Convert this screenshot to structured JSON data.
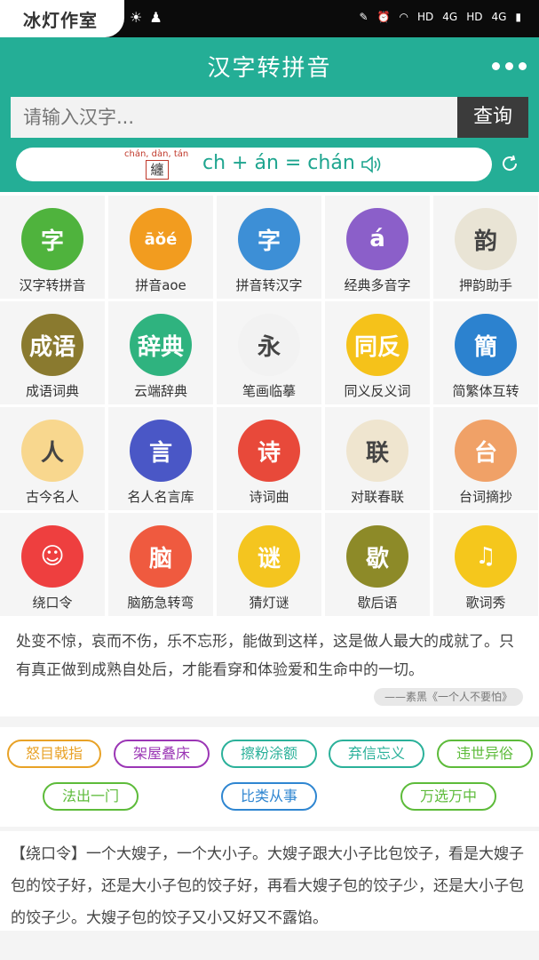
{
  "status_bar": {
    "brand": "冰灯作室",
    "signal_labels": [
      "HD",
      "4G",
      "HD",
      "4G"
    ]
  },
  "app_bar": {
    "title": "汉字转拼音"
  },
  "search": {
    "placeholder": "请输入汉字...",
    "button_label": "查询"
  },
  "pinyin_demo": {
    "small_pinyin": "chán, dàn, tán",
    "character": "纏",
    "formula": "ch + án = chán"
  },
  "grid": [
    {
      "label": "汉字转拼音",
      "icon": "hanzi-to-pinyin-icon",
      "color": "#4fb33d",
      "glyph": "字"
    },
    {
      "label": "拼音aoe",
      "icon": "pinyin-aoe-icon",
      "color": "#f29c1f",
      "glyph": "āǒé"
    },
    {
      "label": "拼音转汉字",
      "icon": "pinyin-to-hanzi-icon",
      "color": "#3d8fd6",
      "glyph": "字"
    },
    {
      "label": "经典多音字",
      "icon": "polyphone-icon",
      "color": "#8b5fc9",
      "glyph": "á"
    },
    {
      "label": "押韵助手",
      "icon": "rhyme-icon",
      "color": "#e9e4d5",
      "glyph": "韵"
    },
    {
      "label": "成语词典",
      "icon": "idiom-dictionary-icon",
      "color": "#8a7a2f",
      "glyph": "成语"
    },
    {
      "label": "云端辞典",
      "icon": "cloud-dictionary-icon",
      "color": "#2fb37f",
      "glyph": "辞典"
    },
    {
      "label": "笔画临摹",
      "icon": "stroke-practice-icon",
      "color": "#f2f2f2",
      "glyph": "永"
    },
    {
      "label": "同义反义词",
      "icon": "synonym-icon",
      "color": "#f5c21a",
      "glyph": "同反"
    },
    {
      "label": "简繁体互转",
      "icon": "simplified-traditional-icon",
      "color": "#2c82cf",
      "glyph": "簡"
    },
    {
      "label": "古今名人",
      "icon": "famous-people-icon",
      "color": "#f8d78e",
      "glyph": "人"
    },
    {
      "label": "名人名言库",
      "icon": "quotes-icon",
      "color": "#4a57c6",
      "glyph": "言"
    },
    {
      "label": "诗词曲",
      "icon": "poetry-icon",
      "color": "#e8493a",
      "glyph": "诗"
    },
    {
      "label": "对联春联",
      "icon": "couplet-icon",
      "color": "#efe5cf",
      "glyph": "联"
    },
    {
      "label": "台词摘抄",
      "icon": "film-quote-icon",
      "color": "#f0a167",
      "glyph": "台"
    },
    {
      "label": "绕口令",
      "icon": "tongue-twister-icon",
      "color": "#ee3f3f",
      "glyph": "☺"
    },
    {
      "label": "脑筋急转弯",
      "icon": "brain-teaser-icon",
      "color": "#ef5a3f",
      "glyph": "脑"
    },
    {
      "label": "猜灯谜",
      "icon": "lantern-riddle-icon",
      "color": "#f4c51f",
      "glyph": "谜"
    },
    {
      "label": "歇后语",
      "icon": "xiehouyu-icon",
      "color": "#8d8a28",
      "glyph": "歇"
    },
    {
      "label": "歌词秀",
      "icon": "lyrics-icon",
      "color": "#f5c71c",
      "glyph": "♫"
    }
  ],
  "quote": {
    "text": "处变不惊，哀而不伤，乐不忘形，能做到这样，这是做人最大的成就了。只有真正做到成熟自处后，才能看穿和体验爱和生命中的一切。",
    "source": "——素黑《一个人不要怕》"
  },
  "idioms": [
    {
      "label": "怒目戟指",
      "color": "#e8a227"
    },
    {
      "label": "架屋叠床",
      "color": "#9b36b5"
    },
    {
      "label": "擦粉涂额",
      "color": "#2bb19a"
    },
    {
      "label": "弃信忘义",
      "color": "#2bb19a"
    },
    {
      "label": "违世异俗",
      "color": "#5dbb3a"
    },
    {
      "label": "法出一门",
      "color": "#5dbb3a"
    },
    {
      "label": "比类从事",
      "color": "#2f86d1"
    },
    {
      "label": "万选万中",
      "color": "#5dbb3a"
    }
  ],
  "tongue_twister": {
    "text": "【绕口令】一个大嫂子，一个大小子。大嫂子跟大小子比包饺子，看是大嫂子包的饺子好，还是大小子包的饺子好，再看大嫂子包的饺子少，还是大小子包的饺子少。大嫂子包的饺子又小又好又不露馅。"
  }
}
